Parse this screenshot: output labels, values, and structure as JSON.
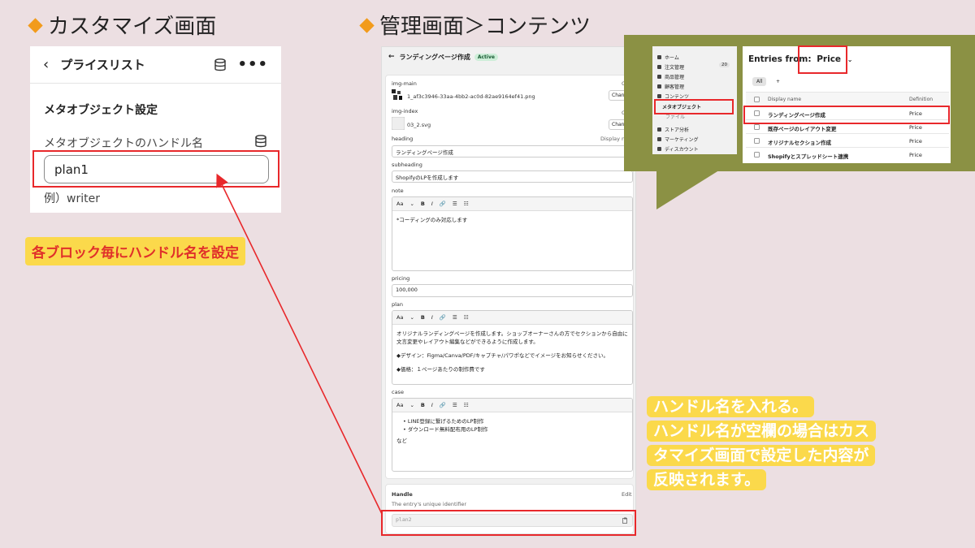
{
  "left_section_title": "カスタマイズ画面",
  "right_section_title": "管理画面＞コンテンツ",
  "customize": {
    "back_icon": "‹",
    "title": "プライスリスト",
    "more_icon": "•••",
    "section_heading": "メタオブジェクト設定",
    "handle_label": "メタオブジェクトのハンドル名",
    "handle_value": "plan1",
    "example": "例）writer"
  },
  "callout_left": "各ブロック毎にハンドル名を設定",
  "callout_right": {
    "line1": "ハンドル名を入れる。",
    "line2": "ハンドル名が空欄の場合はカス",
    "line3": "タマイズ画面で設定した内容が",
    "line4": "反映されます。"
  },
  "admin": {
    "back_icon": "←",
    "title": "ランディングページ作成",
    "status": "Active",
    "img_main_label": "img-main",
    "img_main_file": "1_af3c3946-33aa-4bb2-ac0d-82ae9164ef41.png",
    "img_main_clear": "Cl",
    "change_label": "Chang",
    "img_index_label": "img-index",
    "img_index_file": "03_2.svg",
    "img_index_clear": "Cl",
    "heading_label": "heading",
    "heading_display": "Display na",
    "heading_value": "ランディングページ作成",
    "subheading_label": "subheading",
    "subheading_value": "ShopifyのLPを作成します",
    "note_label": "note",
    "note_text": "*コーディングのみ対応します",
    "pricing_label": "pricing",
    "pricing_value": "100,000",
    "plan_label": "plan",
    "plan_p1": "オリジナルランディングページを作成します。ショップオーナーさんの方でセクションから自由に文言変更やレイアウト編集などができるように作成します。",
    "plan_p2": "◆デザイン：Figma/Canva/PDF/キャプチャ/パワポなどでイメージをお知らせください。",
    "plan_p3": "◆価格：１ページあたりの制作費です",
    "case_label": "case",
    "case_item1": "LINE登録に繋げるためのLP制作",
    "case_item2": "ダウンロード無料配布用のLP制作",
    "case_etc": "など",
    "toolbar": {
      "format": "Aa",
      "caret": "⌄",
      "bold": "B",
      "italic": "I",
      "link": "🔗",
      "ul": "☰",
      "ol": "☷"
    },
    "handle_title": "Handle",
    "handle_edit": "Edit",
    "handle_desc": "The entry's unique identifier",
    "handle_value": "plan2"
  },
  "nav": {
    "items": [
      "ホーム",
      "注文管理",
      "商品管理",
      "顧客管理",
      "コンテンツ",
      "メタオブジェクト",
      "ファイル",
      "ストア分析",
      "マーケティング",
      "ディスカウント"
    ],
    "orders_count": "20"
  },
  "entries": {
    "title_prefix": "Entries from:",
    "title_value": "Price",
    "tab_all": "All",
    "tab_add": "+",
    "col_name": "Display name",
    "col_def": "Definition",
    "rows": [
      {
        "name": "ランディングページ作成",
        "def": "Price"
      },
      {
        "name": "既存ページのレイアウト変更",
        "def": "Price"
      },
      {
        "name": "オリジナルセクション作成",
        "def": "Price"
      },
      {
        "name": "Shopifyとスプレッドシート連携",
        "def": "Price"
      }
    ]
  }
}
